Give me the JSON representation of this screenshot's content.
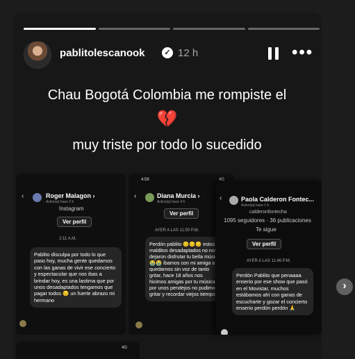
{
  "story": {
    "username": "pablitolescanook",
    "verified_icon": "verified-badge-icon",
    "time": "12 h",
    "caption_line1": "Chau Bogotá Colombia me rompiste el",
    "heart": "💔",
    "caption_line2": "muy triste por todo lo sucedido",
    "progress": {
      "segments": 4,
      "active": 1
    }
  },
  "screens": {
    "s1": {
      "name": "Roger Malagon",
      "chevron": "›",
      "sub": "Activo(a) hace 2 h",
      "source": "Instagram",
      "button": "Ver perfil",
      "stamp": "2:11 A.M.",
      "message": "Pablito disculpa por todo lo que paso hoy, mucha gente quedamos con las ganas de vivir ese concierto y espectacular que nos ibas a brindar hoy, es una lastima que por unos desadaptados tengamos que pagar todos 😔 un fuerte abrazo mi hermano"
    },
    "s2": {
      "clock": "4:58",
      "network": "4G",
      "name": "Diana Murcia",
      "chevron": "›",
      "sub": "Activo(a) hace 4 h",
      "button": "Ver perfil",
      "stamp": "AYER A LAS 11:50 P.M.",
      "message": "Perdón pablito 😔😔😔 estos malditos desadaptados no nos dejaron disfrutar tu bella música 😭😭 íbamos con mi amiga a quedarnos sin voz de tanto gritar, hace 18 años nos hicimos amigas por tu música y por unos pendejos no pudimos gritar y recordar viejos tiempos."
    },
    "s3": {
      "name": "Paola Calderon Fontec...",
      "sub": "Activo(a) hace 1 h",
      "handle": "calderonfontecha",
      "stats": "1095 seguidores · 36 publicaciones",
      "follows": "Te sigue",
      "button": "Ver perfil",
      "stamp": "AYER A LAS 11:46 P.M.",
      "message": "Perdón Pablito que penaaaa enserio por ese show que pasó en el Movistar, muchos estábamos ahí con ganas de escucharte y gozar el concierto enserio perdón perdón 🙏"
    },
    "s4": {
      "network": "4G"
    }
  },
  "nav": {
    "next_symbol": "›"
  }
}
